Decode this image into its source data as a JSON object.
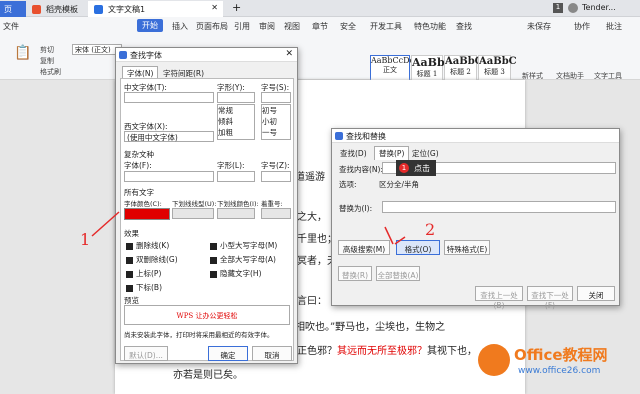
{
  "tabs": [
    {
      "label": "页"
    },
    {
      "label": "稻壳模板"
    },
    {
      "label": "文字文稿1"
    }
  ],
  "tab_add": "+",
  "user": "Tender...",
  "menu": [
    "文件",
    "开始",
    "插入",
    "页面布局",
    "引用",
    "审阅",
    "视图",
    "章节",
    "安全",
    "开发工具",
    "特色功能",
    "查找"
  ],
  "right_menu": [
    "未保存",
    "协作",
    "批注"
  ],
  "ribbon": {
    "cut": "剪切",
    "copy": "复制",
    "format_painter": "格式刷",
    "font_name": "宋体 (正文)",
    "styles": [
      {
        "preview": "AaBbCcDd",
        "name": "正文"
      },
      {
        "preview": "AaBb",
        "name": "标题 1"
      },
      {
        "preview": "AaBbC",
        "name": "标题 2"
      },
      {
        "preview": "AaBbC",
        "name": "标题 3"
      }
    ],
    "new_style": "新样式",
    "text_assistant": "文档助手",
    "text_tools": "文字工具"
  },
  "document": {
    "lines": [
      {
        "text": "道遥游"
      },
      {
        "text": "之大，"
      },
      {
        "text": "千里也；"
      },
      {
        "text": "冥者，天"
      },
      {
        "text": "言曰："
      },
      {
        "text": "马也，尘埃也，生物之以息相吹也。”野马也，尘埃也，生物之"
      },
      {
        "text": "其正色邪？",
        "red": "其远而无所至极邪？",
        "tail": "其视下也，"
      },
      {
        "text": "亦若是则已矣。"
      }
    ]
  },
  "font_dialog": {
    "title": "查找字体",
    "tabs": [
      "字体(N)",
      "字符间距(R)"
    ],
    "chinese_font": "中文字体(T):",
    "style": "字形(Y):",
    "size": "字号(S):",
    "styles": [
      "常规",
      "倾斜",
      "加粗"
    ],
    "sizes": [
      "初号",
      "小初",
      "一号"
    ],
    "western_font": "西文字体(X):",
    "western_value": "(使用中文字体)",
    "complex": "复杂文种",
    "cfont": "字体(F):",
    "cstyle": "字形(L):",
    "csize": "字号(Z):",
    "all_text": "所有文字",
    "font_color": "字体颜色(C):",
    "underline": "下划线线型(U):",
    "underline_color": "下划线颜色(I):",
    "emphasis": "着重号:",
    "effects": "效果",
    "effect_items": [
      "删除线(K)",
      "双删除线(G)",
      "上标(P)",
      "下标(B)",
      "小型大写字母(M)",
      "全部大写字母(A)",
      "隐藏文字(H)"
    ],
    "preview": "预览",
    "preview_text": "WPS 让办公更轻松",
    "note": "尚未安装此字体，打印时将采用最相近的有效字体。",
    "default_btn": "默认(D)...",
    "ok_btn": "确定",
    "cancel_btn": "取消",
    "color": "#e00000"
  },
  "find_dialog": {
    "title": "查找和替换",
    "tabs": [
      "查找(D)",
      "替换(P)",
      "定位(G)"
    ],
    "find_label": "查找内容(N):",
    "options_label": "选项:",
    "options_value": "区分全/半角",
    "replace_label": "替换为(I):",
    "advanced": "高级搜索(M)",
    "format": "格式(O)",
    "special": "特殊格式(E)",
    "replace_btn": "替换(R)",
    "replace_all": "全部替换(A)",
    "find_prev": "查找上一处(B)",
    "find_next": "查找下一处(F)",
    "close": "关闭"
  },
  "annotations": {
    "num1": "1",
    "num2": "2",
    "bubble_num": "1",
    "bubble_text": "点击"
  },
  "watermark": {
    "brand": "Office教程网",
    "url": "www.office26.com"
  }
}
